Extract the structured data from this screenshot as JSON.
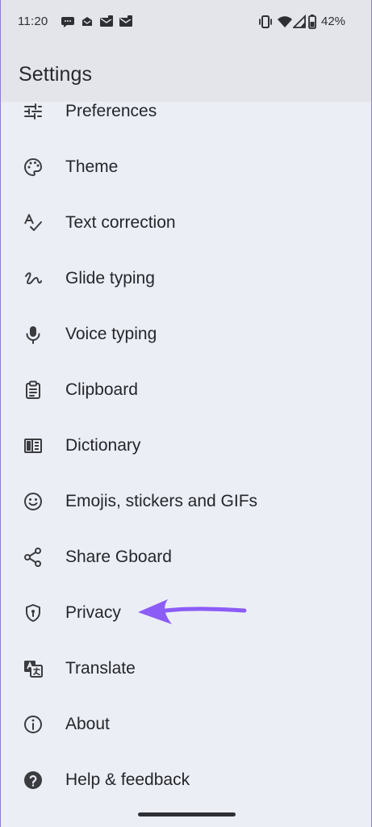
{
  "status_bar": {
    "time": "11:20",
    "battery_percent": "42%",
    "left_icons": [
      "message-icon",
      "cloud-mail-icon",
      "mail-icon",
      "mail-icon"
    ],
    "right_icons": [
      "vibrate-icon",
      "wifi-icon",
      "signal-icon",
      "battery-icon"
    ]
  },
  "app_bar": {
    "title": "Settings"
  },
  "settings_list": {
    "items": [
      {
        "label": "Preferences",
        "icon": "sliders-icon"
      },
      {
        "label": "Theme",
        "icon": "palette-icon"
      },
      {
        "label": "Text correction",
        "icon": "spellcheck-icon"
      },
      {
        "label": "Glide typing",
        "icon": "gesture-icon"
      },
      {
        "label": "Voice typing",
        "icon": "microphone-icon"
      },
      {
        "label": "Clipboard",
        "icon": "clipboard-icon"
      },
      {
        "label": "Dictionary",
        "icon": "dictionary-icon"
      },
      {
        "label": "Emojis, stickers and GIFs",
        "icon": "emoji-icon"
      },
      {
        "label": "Share Gboard",
        "icon": "share-icon"
      },
      {
        "label": "Privacy",
        "icon": "shield-icon"
      },
      {
        "label": "Translate",
        "icon": "translate-icon"
      },
      {
        "label": "About",
        "icon": "info-icon"
      },
      {
        "label": "Help & feedback",
        "icon": "help-icon"
      }
    ]
  },
  "annotation": {
    "points_to": "Privacy",
    "color": "#8b5cf6",
    "icon": "arrow-left-icon"
  },
  "colors": {
    "frame_border": "#8f7ad8",
    "background": "#eceef6",
    "app_bar": "#e3e5eb",
    "text": "#24262a",
    "icon": "#3a3c40"
  }
}
